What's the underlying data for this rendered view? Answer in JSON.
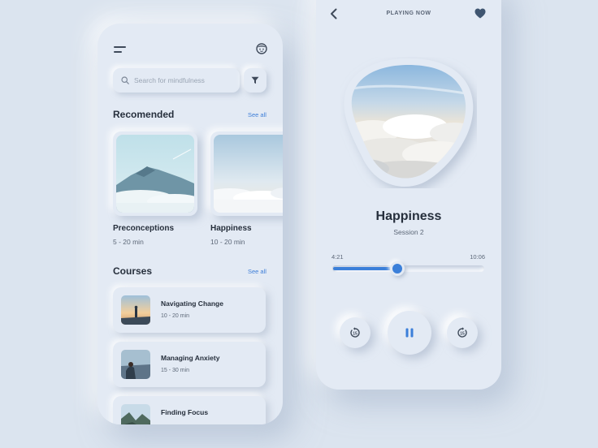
{
  "left_screen": {
    "search": {
      "placeholder": "Search for mindfulness"
    },
    "recommended": {
      "title": "Recomended",
      "see_all": "See all",
      "items": [
        {
          "title": "Preconceptions",
          "duration": "5 - 20 min"
        },
        {
          "title": "Happiness",
          "duration": "10 - 20 min"
        }
      ]
    },
    "courses": {
      "title": "Courses",
      "see_all": "See all",
      "items": [
        {
          "title": "Navigating Change",
          "duration": "10 - 20 min"
        },
        {
          "title": "Managing Anxiety",
          "duration": "15 - 30 min"
        },
        {
          "title": "Finding Focus",
          "duration": ""
        }
      ]
    }
  },
  "right_screen": {
    "header": {
      "label": "PLAYING NOW"
    },
    "track": {
      "title": "Happiness",
      "subtitle": "Session 2"
    },
    "progress": {
      "elapsed": "4:21",
      "total": "10:06",
      "fraction": 0.43
    }
  },
  "icons": {
    "menu": "hamburger-menu-icon",
    "avatar": "smiley-avatar-icon",
    "search": "magnifier-icon",
    "filter": "funnel-icon",
    "back": "chevron-left-icon",
    "favorite": "heart-icon",
    "rewind": "rewind-15-icon",
    "pause": "pause-icon",
    "forward": "forward-15-icon"
  },
  "colors": {
    "background": "#dbe4ef",
    "surface": "#e3eaf4",
    "accent": "#3b7fd9",
    "text": "#262f3c"
  }
}
